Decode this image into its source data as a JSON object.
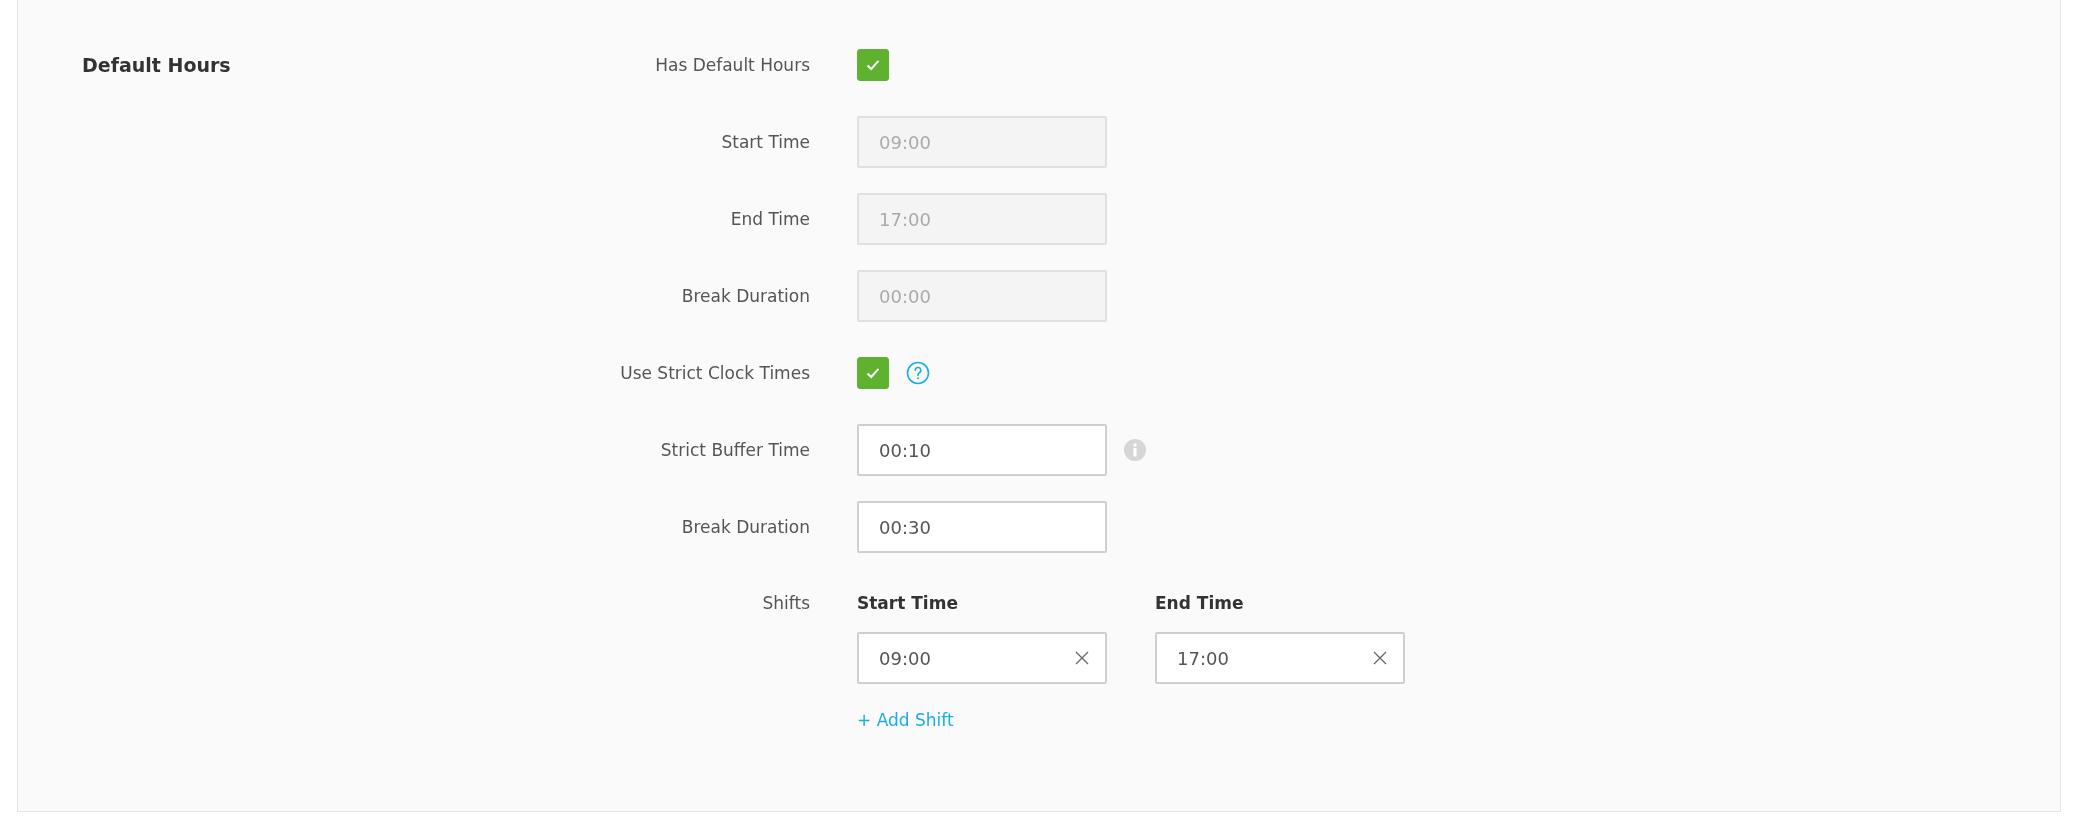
{
  "section": {
    "title": "Default Hours"
  },
  "fields": [
    {
      "kind": "checkbox",
      "label": "Has Default Hours",
      "checked": true
    },
    {
      "kind": "time",
      "label": "Start Time",
      "value": "09:00",
      "disabled": true
    },
    {
      "kind": "time",
      "label": "End Time",
      "value": "17:00",
      "disabled": true
    },
    {
      "kind": "time",
      "label": "Break Duration",
      "value": "00:00",
      "disabled": true
    },
    {
      "kind": "checkbox",
      "label": "Use Strict Clock Times",
      "checked": true,
      "help_icon": true
    },
    {
      "kind": "time",
      "label": "Strict Buffer Time",
      "value": "00:10",
      "disabled": false,
      "info_icon": true
    },
    {
      "kind": "time",
      "label": "Break Duration",
      "value": "00:30",
      "disabled": false
    }
  ],
  "shifts": {
    "label": "Shifts",
    "columns": [
      "Start Time",
      "End Time"
    ],
    "rows": [
      {
        "start": "09:00",
        "end": "17:00"
      }
    ],
    "add_link": "+ Add Shift"
  }
}
